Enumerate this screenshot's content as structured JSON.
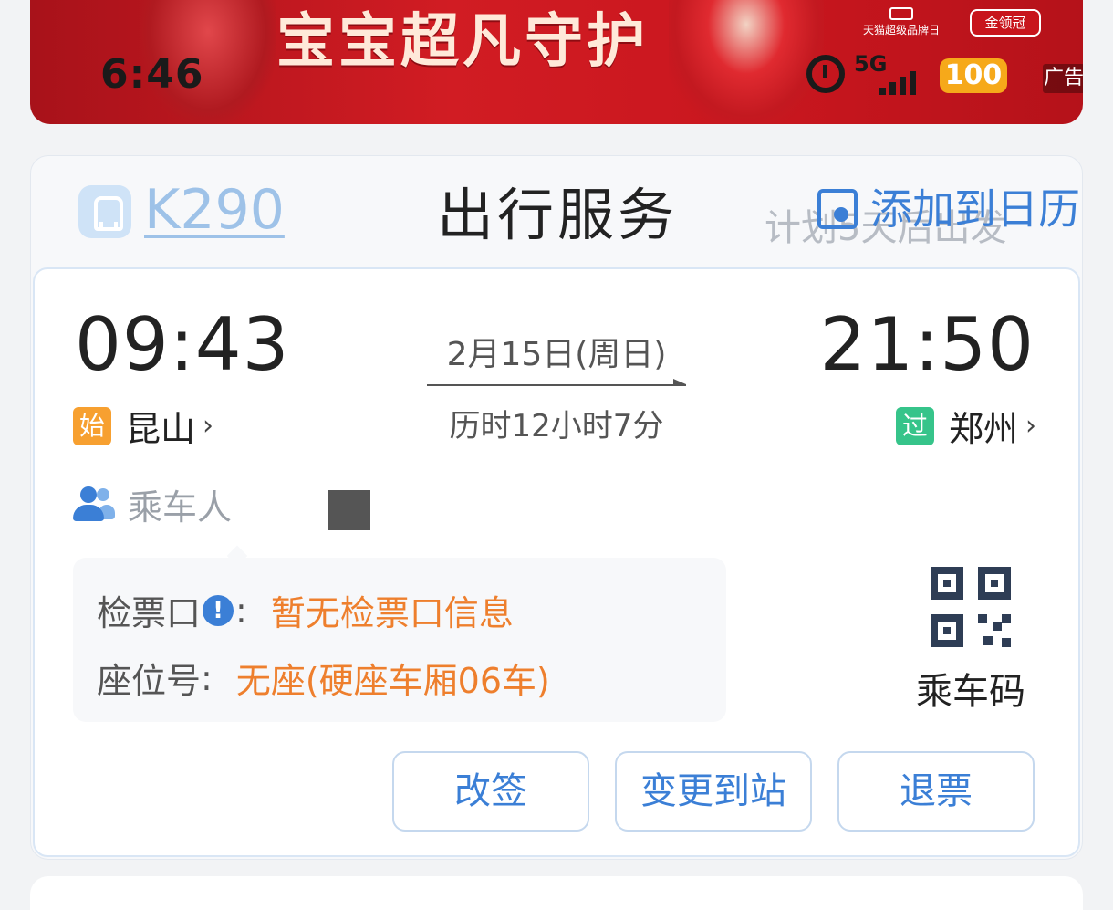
{
  "banner": {
    "slogan": "宝宝超凡守护",
    "brand_tmall": "天猫超级品牌日",
    "brand_jlg": "金领冠",
    "ad_label": "广告"
  },
  "status_bar": {
    "time": "6:46",
    "network": "5G",
    "battery": "100"
  },
  "header": {
    "train_number": "K290",
    "title": "出行服务",
    "plan_text": "计划5天后出发",
    "add_calendar": "添加到日历"
  },
  "trip": {
    "departure_time": "09:43",
    "arrival_time": "21:50",
    "date": "2月15日(周日)",
    "duration": "历时12小时7分",
    "departure_station": "昆山",
    "departure_tag": "始",
    "arrival_station": "郑州",
    "arrival_tag": "过",
    "chevron": "›"
  },
  "passenger": {
    "label": "乘车人"
  },
  "details": {
    "gate_label": "检票口",
    "gate_value": "暂无检票口信息",
    "seat_label": "座位号",
    "seat_value": "无座(硬座车厢06车)",
    "colon": ":"
  },
  "qr": {
    "label": "乘车码"
  },
  "actions": {
    "change": "改签",
    "change_station": "变更到站",
    "refund": "退票"
  },
  "colors": {
    "accent": "#3b7fd6",
    "warning": "#ee7f2d",
    "start_tag": "#f7a030",
    "pass_tag": "#36c48a",
    "banner": "#c9161e"
  }
}
